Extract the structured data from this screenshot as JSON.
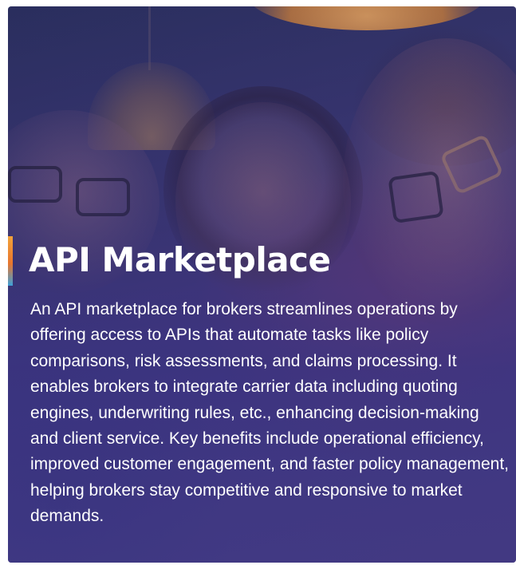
{
  "card": {
    "title": "API Marketplace",
    "description": "An API marketplace for brokers streamlines operations by offering access to APIs that automate tasks like policy comparisons, risk assessments, and claims processing. It enables brokers to integrate carrier data including quoting engines, underwriting rules, etc., enhancing decision-making and client service. Key benefits include operational efficiency, improved customer engagement, and faster policy management, helping brokers stay competitive and responsive to market demands.",
    "accent_colors": [
      "#f2a33a",
      "#e8762e",
      "#3ea0d8"
    ],
    "overlay_color": "#3c3782"
  }
}
